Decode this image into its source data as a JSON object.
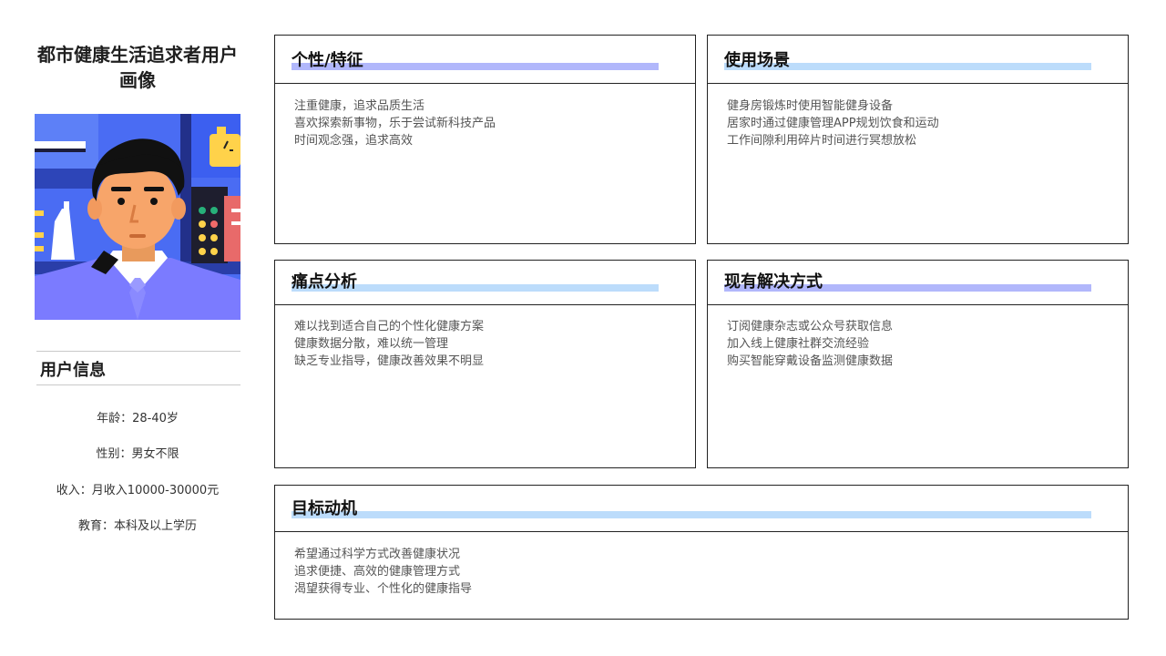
{
  "persona": {
    "title": "都市健康生活追求者用户画像"
  },
  "user_info": {
    "heading": "用户信息",
    "items": [
      "年龄：28-40岁",
      "性别：男女不限",
      "收入：月收入10000-30000元",
      "教育：本科及以上学历"
    ]
  },
  "cards": {
    "traits": {
      "title": "个性/特征",
      "lines": [
        "注重健康，追求品质生活",
        "喜欢探索新事物，乐于尝试新科技产品",
        "时间观念强，追求高效"
      ]
    },
    "scenarios": {
      "title": "使用场景",
      "lines": [
        "健身房锻炼时使用智能健身设备",
        "居家时通过健康管理APP规划饮食和运动",
        "工作间隙利用碎片时间进行冥想放松"
      ]
    },
    "pain_points": {
      "title": "痛点分析",
      "lines": [
        "难以找到适合自己的个性化健康方案",
        "健康数据分散，难以统一管理",
        "缺乏专业指导，健康改善效果不明显"
      ]
    },
    "solutions": {
      "title": "现有解决方式",
      "lines": [
        "订阅健康杂志或公众号获取信息",
        "加入线上健康社群交流经验",
        "购买智能穿戴设备监测健康数据"
      ]
    },
    "motivation": {
      "title": "目标动机",
      "lines": [
        "希望通过科学方式改善健康状况",
        "追求便捷、高效的健康管理方式",
        "渴望获得专业、个性化的健康指导"
      ]
    }
  },
  "colors": {
    "bar_purple": "#b1b7fb",
    "bar_blue": "#bcdcfb",
    "card_border": "#222222"
  }
}
